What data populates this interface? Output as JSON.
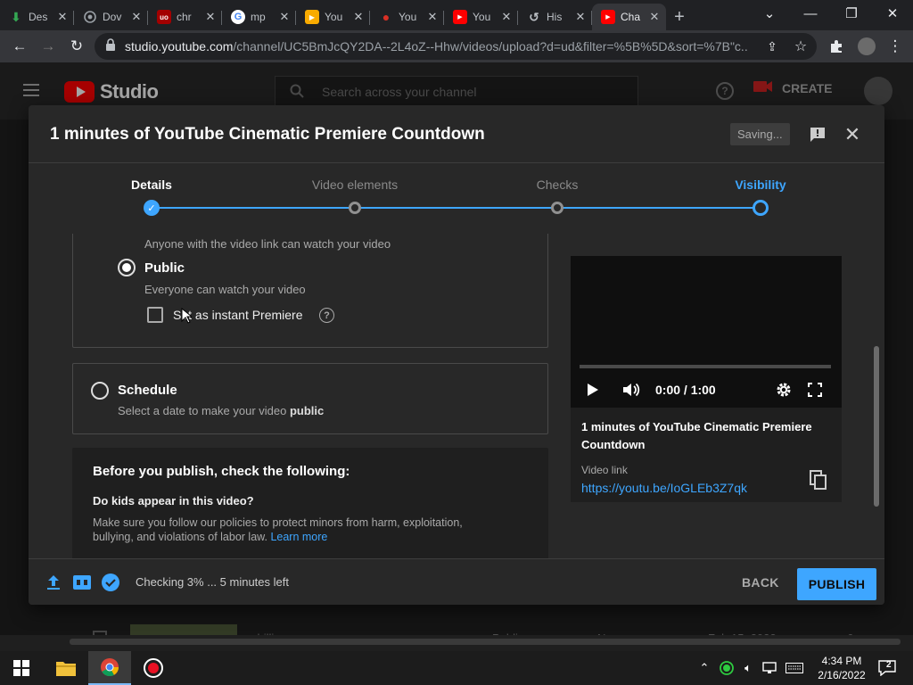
{
  "browser": {
    "tabs": [
      {
        "title": "Des",
        "favicon": "download-icon",
        "color": "#34a853"
      },
      {
        "title": "Dov",
        "favicon": "globe-icon",
        "color": "#9aa0a6"
      },
      {
        "title": "chr",
        "favicon": "ublock-icon",
        "color": "#a30000"
      },
      {
        "title": "mp",
        "favicon": "google-icon",
        "color": "#ffffff"
      },
      {
        "title": "You",
        "favicon": "youtube-studio-icon",
        "color": "#f9ab00"
      },
      {
        "title": "You",
        "favicon": "location-pin-icon",
        "color": "#d93025"
      },
      {
        "title": "You",
        "favicon": "youtube-icon",
        "color": "#ff0000"
      },
      {
        "title": "His",
        "favicon": "history-icon",
        "color": "#9aa0a6"
      },
      {
        "title": "Cha",
        "favicon": "youtube-icon",
        "color": "#ff0000"
      }
    ],
    "url_main": "studio.youtube.com",
    "url_rest": "/channel/UC5BmJcQY2DA--2L4oZ--Hhw/videos/upload?d=ud&filter=%5B%5D&sort=%7B\"c..."
  },
  "studio": {
    "logo_text": "Studio",
    "search_placeholder": "Search across your channel",
    "create_label": "CREATE",
    "bg_row": {
      "title": "chilling",
      "visibility": "Public",
      "restrictions": "None",
      "date": "Feb 15, 2022",
      "count": "6"
    }
  },
  "dialog": {
    "title": "1 minutes of YouTube Cinematic Premiere Countdown",
    "saving_label": "Saving...",
    "steps": [
      {
        "label": "Details",
        "state": "done"
      },
      {
        "label": "Video elements",
        "state": "pending"
      },
      {
        "label": "Checks",
        "state": "pending"
      },
      {
        "label": "Visibility",
        "state": "current"
      }
    ],
    "unlisted_sub": "Anyone with the video link can watch your video",
    "public": {
      "title": "Public",
      "sub": "Everyone can watch your video",
      "selected": true
    },
    "premiere_label": "Set as instant Premiere",
    "schedule": {
      "title": "Schedule",
      "sub_prefix": "Select a date to make your video ",
      "sub_bold": "public"
    },
    "checklist": {
      "heading": "Before you publish, check the following:",
      "question": "Do kids appear in this video?",
      "body": "Make sure you follow our policies to protect minors from harm, exploitation, bullying, and violations of labor law.",
      "learn_more": "Learn more"
    },
    "preview": {
      "time": "0:00 / 1:00",
      "title": "1 minutes of YouTube Cinematic Premiere Countdown",
      "link_label": "Video link",
      "link": "https://youtu.be/IoGLEb3Z7qk"
    },
    "footer": {
      "status": "Checking 3% ... 5 minutes left",
      "back_label": "BACK",
      "publish_label": "PUBLISH"
    }
  },
  "taskbar": {
    "time": "4:34 PM",
    "date": "2/16/2022",
    "notification_count": "2"
  },
  "colors": {
    "accent": "#3ea6ff",
    "brand_red": "#ff0000"
  }
}
